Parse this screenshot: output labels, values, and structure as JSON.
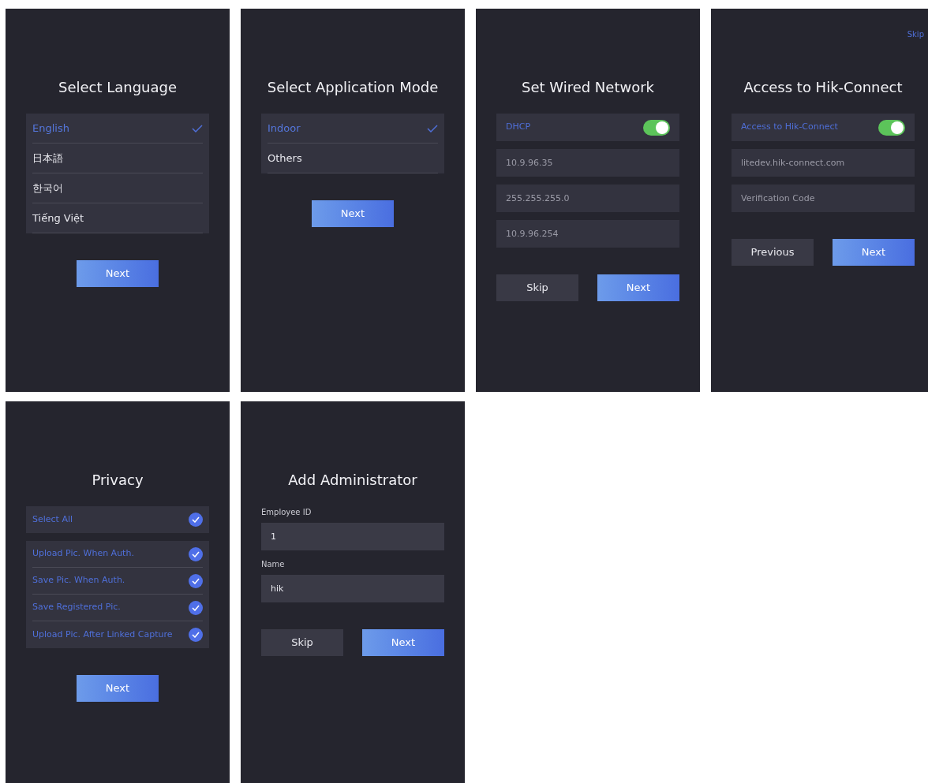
{
  "screens": [
    {
      "title": "Select Language",
      "blocks": [
        {
          "kind": "options",
          "items": [
            {
              "label": "English",
              "selected": true
            },
            {
              "label": "日本語",
              "selected": false
            },
            {
              "label": "한국어",
              "selected": false
            },
            {
              "label": "Tiếng Việt",
              "selected": false
            }
          ]
        }
      ],
      "buttons": [
        {
          "label": "Next",
          "kind": "primary"
        }
      ]
    },
    {
      "title": "Select Application Mode",
      "blocks": [
        {
          "kind": "options",
          "items": [
            {
              "label": "Indoor",
              "selected": true
            },
            {
              "label": "Others",
              "selected": false
            }
          ]
        }
      ],
      "buttons": [
        {
          "label": "Next",
          "kind": "primary"
        }
      ]
    },
    {
      "title": "Set Wired Network",
      "blocks": [
        {
          "kind": "toggle",
          "label": "DHCP",
          "on": true
        },
        {
          "kind": "field",
          "value": "10.9.96.35"
        },
        {
          "kind": "field",
          "value": "255.255.255.0"
        },
        {
          "kind": "field",
          "value": "10.9.96.254"
        }
      ],
      "buttons": [
        {
          "label": "Skip",
          "kind": "secondary"
        },
        {
          "label": "Next",
          "kind": "primary"
        }
      ]
    },
    {
      "top_link": "Skip",
      "title": "Access to Hik-Connect",
      "blocks": [
        {
          "kind": "toggle",
          "label": "Access to Hik-Connect",
          "on": true
        },
        {
          "kind": "field",
          "value": "litedev.hik-connect.com"
        },
        {
          "kind": "field",
          "placeholder": "Verification Code"
        }
      ],
      "buttons": [
        {
          "label": "Previous",
          "kind": "secondary"
        },
        {
          "label": "Next",
          "kind": "primary"
        }
      ]
    },
    {
      "title": "Privacy",
      "blocks": [
        {
          "kind": "checks",
          "items": [
            {
              "label": "Select All",
              "checked": true
            }
          ]
        },
        {
          "kind": "checks",
          "items": [
            {
              "label": "Upload Pic. When Auth.",
              "checked": true
            },
            {
              "label": "Save Pic. When Auth.",
              "checked": true
            },
            {
              "label": "Save Registered Pic.",
              "checked": true
            },
            {
              "label": "Upload Pic. After Linked Capture",
              "checked": true
            }
          ]
        }
      ],
      "buttons": [
        {
          "label": "Next",
          "kind": "primary"
        }
      ]
    },
    {
      "title": "Add Administrator",
      "blocks": [
        {
          "kind": "labeled_field",
          "label": "Employee ID",
          "value": "1"
        },
        {
          "kind": "labeled_field",
          "label": "Name",
          "value": "hik"
        }
      ],
      "buttons": [
        {
          "label": "Skip",
          "kind": "secondary"
        },
        {
          "label": "Next",
          "kind": "primary"
        }
      ]
    }
  ]
}
